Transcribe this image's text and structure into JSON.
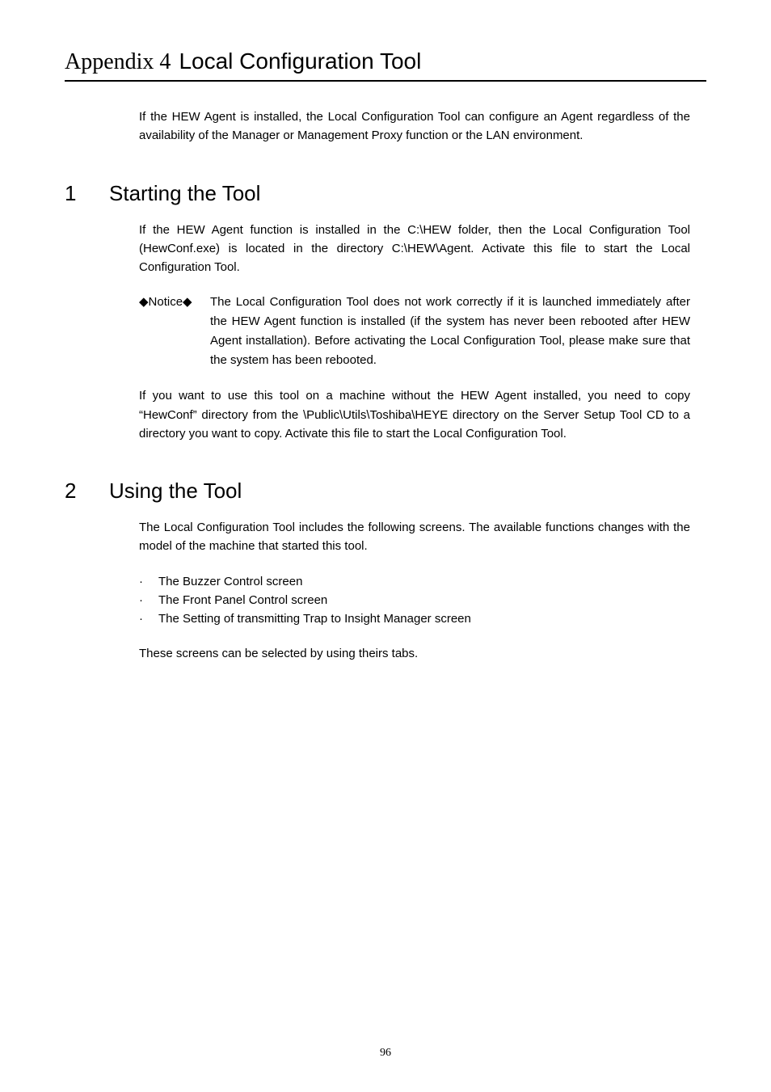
{
  "header": {
    "appendix_label": "Appendix 4",
    "appendix_title": "Local Configuration Tool"
  },
  "intro": "If the HEW Agent is installed, the Local Configuration Tool can configure an Agent regardless of the availability of the Manager or Management Proxy function or the LAN environment.",
  "section1": {
    "number": "1",
    "title": "Starting the Tool",
    "para1": "If the HEW Agent function is installed in the C:\\HEW folder, then the Local Configuration Tool (HewConf.exe) is located in the directory C:\\HEW\\Agent. Activate this file to start the Local Configuration Tool.",
    "notice_label": "◆Notice◆",
    "notice_text": "The Local Configuration Tool does not work correctly if it is launched immediately after the HEW Agent function is installed (if the system has never been rebooted after HEW Agent installation). Before activating the Local Configuration Tool, please make sure that the system has been rebooted.",
    "para2": "If you want to use this tool on a machine without the HEW Agent installed, you need to copy “HewConf” directory from the \\Public\\Utils\\Toshiba\\HEYE directory on the Server Setup Tool CD to a directory you want to copy. Activate this file to start the Local Configuration Tool."
  },
  "section2": {
    "number": "2",
    "title": "Using the Tool",
    "para1": "The Local Configuration Tool includes the following screens. The available functions changes with the model of the machine that started this tool.",
    "bullets": [
      "The Buzzer Control screen",
      "The Front Panel Control screen",
      "The Setting of transmitting Trap to Insight Manager screen"
    ],
    "para2": "These screens can be selected by using theirs tabs."
  },
  "bullet_char": "·",
  "page_number": "96"
}
